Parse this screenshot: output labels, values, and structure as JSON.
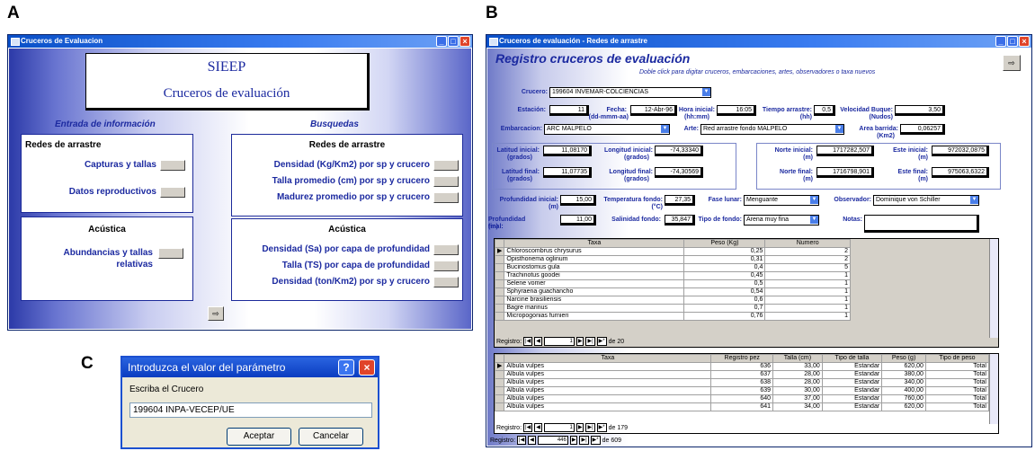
{
  "panel_labels": {
    "a": "A",
    "b": "B",
    "c": "C"
  },
  "a": {
    "title": "Cruceros de Evaluacion",
    "header_title": "SIEEP",
    "header_subtitle": "Cruceros de evaluación",
    "entrada": "Entrada de información",
    "busquedas": "Busquedas",
    "left": {
      "redes": "Redes de arrastre",
      "capturas": "Capturas y tallas",
      "datos": "Datos reproductivos",
      "acustica": "Acústica",
      "abund1": "Abundancias y tallas",
      "abund2": "relativas"
    },
    "right": {
      "redes": "Redes de arrastre",
      "densidad": "Densidad (Kg/Km2) por sp y crucero",
      "talla": "Talla promedio (cm) por sp y crucero",
      "madurez": "Madurez promedio por sp y crucero",
      "acustica": "Acústica",
      "sa": "Densidad (Sa) por capa de profundidad",
      "ts": "Talla (TS) por capa de profundidad",
      "ton": "Densidad (ton/Km2) por sp y crucero"
    }
  },
  "b": {
    "title": "Cruceros de evaluación - Redes de arrastre",
    "heading": "Registro cruceros de evaluación",
    "hint": "Doble click para digitar cruceros, embarcaciones, artes, observadores o taxa nuevos",
    "l": {
      "crucero": "Crucero:",
      "estacion": "Estación:",
      "fecha": "Fecha:",
      "fecha_fmt": "(dd-mmm-aa)",
      "hora": "Hora inicial:",
      "hora_fmt": "(hh:mm)",
      "tiempo": "Tiempo arrastre:",
      "tiempo_u": "(hh)",
      "vel": "Velocidad Buque:",
      "vel_u": "(Nudos)",
      "emb": "Embarcacion:",
      "arte": "Arte:",
      "area": "Area barrida:",
      "area_u": "(Km2)",
      "lat_i": "Latitud inicial:",
      "lon_i": "Longitud inicial:",
      "lat_f": "Latitud final:",
      "lon_f": "Longitud final:",
      "grados": "(grados)",
      "norte_i": "Norte inicial:",
      "este_i": "Este inicial:",
      "norte_f": "Norte final:",
      "este_f": "Este final:",
      "m": "(m)",
      "prof_i": "Profundidad inicial:",
      "prof_f": "Profundidad final:",
      "temp": "Temperatura fondo:",
      "temp_u": "(°C)",
      "sal": "Salinidad fondo:",
      "fase": "Fase lunar:",
      "tipo": "Tipo de fondo:",
      "obs": "Observador:",
      "notas": "Notas:"
    },
    "v": {
      "crucero": "199604 INVEMAR-COLCIENCIAS",
      "estacion": "11",
      "fecha": "12-Abr-96",
      "hora": "16:05",
      "tiempo": "0,5",
      "vel": "3,50",
      "emb": "ARC MALPELO",
      "arte": "Red arrastre fondo MALPELO",
      "area": "0,06257",
      "lat_i": "11,08170",
      "lon_i": "-74,33340",
      "lat_f": "11,07735",
      "lon_f": "-74,30569",
      "norte_i": "1717282,507",
      "este_i": "972032,0875",
      "norte_f": "1716798,901",
      "este_f": "975063,6322",
      "prof_i": "15,00",
      "prof_f": "11,00",
      "temp": "27,35",
      "sal": "35,847",
      "fase": "Menguante",
      "tipo": "Arena muy fina",
      "obs": "Dominique von Schiller"
    },
    "grid1": {
      "headers": [
        "Taxa",
        "Peso (Kg)",
        "Numero"
      ],
      "rows": [
        [
          "Chloroscombrus chrysurus",
          "0,25",
          "2"
        ],
        [
          "Opisthonema oglinum",
          "0,31",
          "2"
        ],
        [
          "Bucinostomus gula",
          "0,4",
          "5"
        ],
        [
          "Trachinotus goodei",
          "0,45",
          "1"
        ],
        [
          "Selene vomer",
          "0,5",
          "1"
        ],
        [
          "Sphyraena guachancho",
          "0,54",
          "1"
        ],
        [
          "Narcine brasiliensis",
          "0,6",
          "1"
        ],
        [
          "Bagre marinus",
          "0,7",
          "1"
        ],
        [
          "Micropogonias furnieri",
          "0,76",
          "1"
        ]
      ],
      "reg": "Registro:",
      "cur": "1",
      "of": "de 20"
    },
    "grid2": {
      "headers": [
        "Taxa",
        "Registro pez",
        "Talla (cm)",
        "Tipo de talla",
        "Peso (g)",
        "Tipo de peso"
      ],
      "rows": [
        [
          "Albula vulpes",
          "636",
          "33,00",
          "Estandar",
          "620,00",
          "Total"
        ],
        [
          "Albula vulpes",
          "637",
          "28,00",
          "Estandar",
          "380,00",
          "Total"
        ],
        [
          "Albula vulpes",
          "638",
          "28,00",
          "Estandar",
          "340,00",
          "Total"
        ],
        [
          "Albula vulpes",
          "639",
          "30,00",
          "Estandar",
          "400,00",
          "Total"
        ],
        [
          "Albula vulpes",
          "640",
          "37,00",
          "Estandar",
          "760,00",
          "Total"
        ],
        [
          "Albula vulpes",
          "641",
          "34,00",
          "Estandar",
          "620,00",
          "Total"
        ]
      ],
      "reg": "Registro:",
      "cur": "1",
      "of": "de 179"
    },
    "footer": {
      "reg": "Registro:",
      "cur": "446",
      "of": "de 609"
    }
  },
  "c": {
    "title": "Introduzca el valor del parámetro",
    "prompt": "Escriba el Crucero",
    "value": "199604 INPA-VECEP/UE",
    "ok": "Aceptar",
    "cancel": "Cancelar"
  }
}
